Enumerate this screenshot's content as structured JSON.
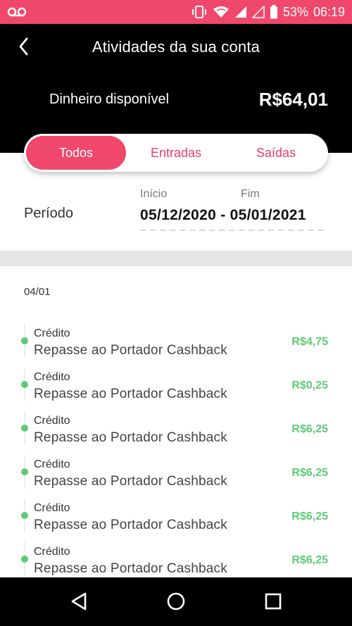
{
  "status_bar": {
    "battery": "53%",
    "time": "06:19",
    "icons": [
      "voicemail-icon",
      "vibrate-icon",
      "wifi-icon",
      "signal-icon",
      "signal-empty-icon",
      "battery-icon"
    ]
  },
  "header": {
    "title": "Atividades da sua conta",
    "balance_label": "Dinheiro disponível",
    "balance_value": "R$64,01"
  },
  "tabs": [
    {
      "label": "Todos",
      "active": true
    },
    {
      "label": "Entradas",
      "active": false
    },
    {
      "label": "Saídas",
      "active": false
    }
  ],
  "period": {
    "label": "Período",
    "start_label": "Início",
    "end_label": "Fim",
    "range": "05/12/2020 - 05/01/2021"
  },
  "date_group": "04/01",
  "transactions": [
    {
      "type": "Crédito",
      "description": "Repasse ao Portador Cashback",
      "amount": "R$4,75"
    },
    {
      "type": "Crédito",
      "description": "Repasse ao Portador Cashback",
      "amount": "R$0,25"
    },
    {
      "type": "Crédito",
      "description": "Repasse ao Portador Cashback",
      "amount": "R$6,25"
    },
    {
      "type": "Crédito",
      "description": "Repasse ao Portador Cashback",
      "amount": "R$6,25"
    },
    {
      "type": "Crédito",
      "description": "Repasse ao Portador Cashback",
      "amount": "R$6,25"
    },
    {
      "type": "Crédito",
      "description": "Repasse ao Portador Cashback",
      "amount": "R$6,25"
    }
  ],
  "colors": {
    "accent": "#f0486c",
    "positive": "#5ccc73",
    "header_bg": "#000000"
  }
}
